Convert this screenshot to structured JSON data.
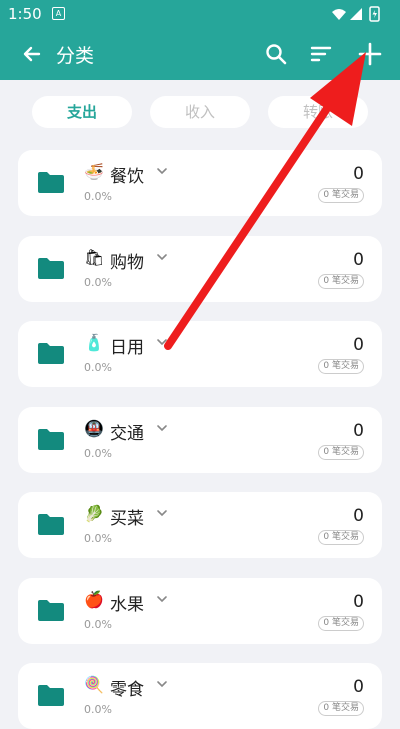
{
  "status": {
    "time": "1:50",
    "notif": "A"
  },
  "appbar": {
    "title": "分类"
  },
  "tabs": [
    {
      "label": "支出",
      "active": true
    },
    {
      "label": "收入",
      "active": false
    },
    {
      "label": "转账",
      "active": false
    }
  ],
  "categories": [
    {
      "emoji": "🍜",
      "name": "餐饮",
      "percent": "0.0%",
      "amount": "0",
      "count": "0 笔交易"
    },
    {
      "emoji": "🛍",
      "name": "购物",
      "percent": "0.0%",
      "amount": "0",
      "count": "0 笔交易"
    },
    {
      "emoji": "🧴",
      "name": "日用",
      "percent": "0.0%",
      "amount": "0",
      "count": "0 笔交易"
    },
    {
      "emoji": "🚇",
      "name": "交通",
      "percent": "0.0%",
      "amount": "0",
      "count": "0 笔交易"
    },
    {
      "emoji": "🥬",
      "name": "买菜",
      "percent": "0.0%",
      "amount": "0",
      "count": "0 笔交易"
    },
    {
      "emoji": "🍎",
      "name": "水果",
      "percent": "0.0%",
      "amount": "0",
      "count": "0 笔交易"
    },
    {
      "emoji": "🍭",
      "name": "零食",
      "percent": "0.0%",
      "amount": "0",
      "count": "0 笔交易"
    }
  ]
}
